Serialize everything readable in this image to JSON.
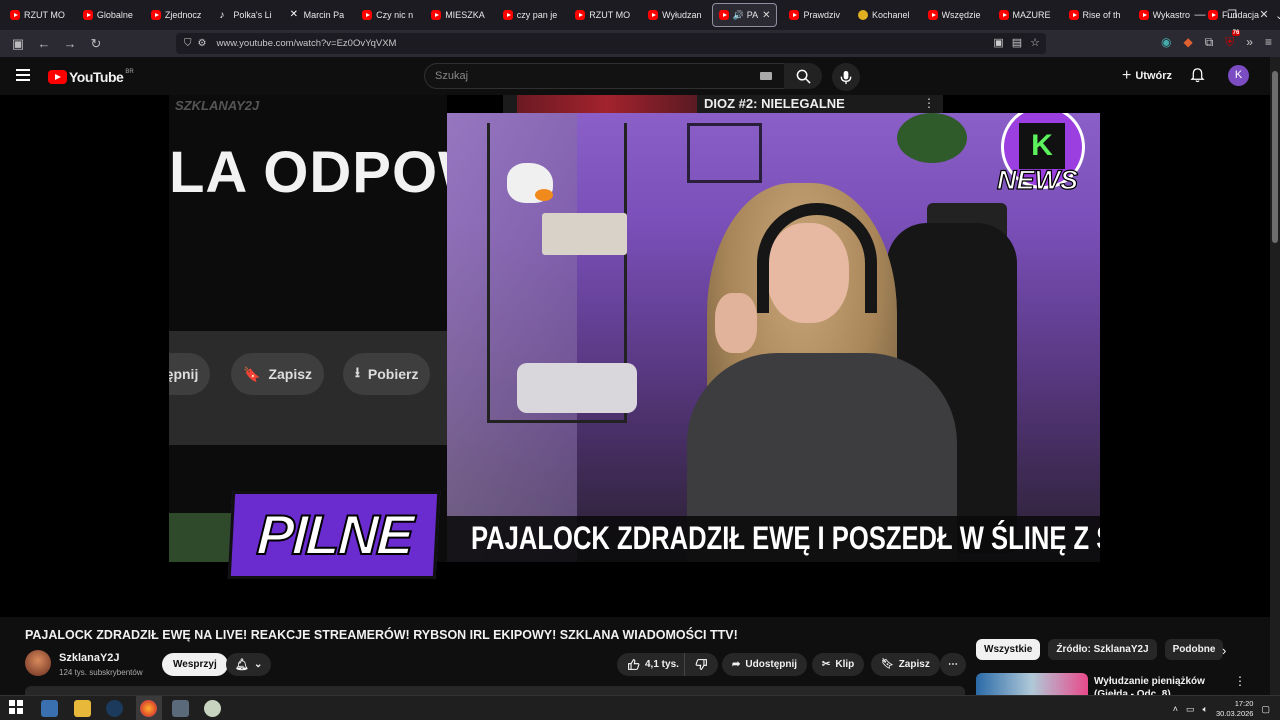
{
  "browser": {
    "tabs": [
      {
        "label": "RZUT MO",
        "icon": "youtube-icon"
      },
      {
        "label": "Globalne",
        "icon": "youtube-icon"
      },
      {
        "label": "Zjednocz",
        "icon": "youtube-icon"
      },
      {
        "label": "Polka's Li",
        "icon": "tiktok-icon"
      },
      {
        "label": "Marcin Pa",
        "icon": "x-icon"
      },
      {
        "label": "Czy nic n",
        "icon": "youtube-icon"
      },
      {
        "label": "MIESZKA",
        "icon": "youtube-icon"
      },
      {
        "label": "czy pan je",
        "icon": "youtube-icon"
      },
      {
        "label": "RZUT MO",
        "icon": "youtube-icon"
      },
      {
        "label": "Wyłudzan",
        "icon": "youtube-icon"
      },
      {
        "label": "PA",
        "icon": "youtube-icon",
        "active": true
      },
      {
        "label": "Prawdziv",
        "icon": "youtube-icon"
      },
      {
        "label": "Kochanel",
        "icon": "emoji-icon"
      },
      {
        "label": "Wszędzie",
        "icon": "youtube-icon"
      },
      {
        "label": "MAZURE",
        "icon": "youtube-icon"
      },
      {
        "label": "Rise of th",
        "icon": "youtube-icon"
      },
      {
        "label": "Wykastro",
        "icon": "youtube-icon"
      },
      {
        "label": "Fundacja",
        "icon": "youtube-icon"
      }
    ],
    "url": "www.youtube.com/watch?v=Ez0OvYqVXM",
    "extension_badge": "76"
  },
  "youtube": {
    "logo_text": "YouTube",
    "country_code": "BR",
    "search_placeholder": "Szukaj",
    "create_label": "Utwórz",
    "avatar_letter": "K"
  },
  "video": {
    "watermark": "SZKLANAY2J",
    "left_big_text": "LA ODPOW",
    "left_buttons": [
      "tępnij",
      "Zapisz",
      "Pobierz"
    ],
    "top_banner": "DIOZ #2: NIELEGALNE",
    "news_logo": "NEWS",
    "news_logo_letter": "K",
    "pilne": "PILNE",
    "lower_third": "PAJALOCK ZDRADZIŁ EWĘ I POSZEDŁ W ŚLINĘ Z S"
  },
  "watch": {
    "title": "PAJALOCK ZDRADZIŁ EWĘ NA LIVE! REAKCJE STREAMERÓW! RYBSON IRL EKIPOWY! SZKLANA WIADOMOŚCI TTV!",
    "channel_name": "SzklanaY2J",
    "subscribers": "124 tys. subskrybentów",
    "support_label": "Wesprzyj",
    "likes": "4,1 tys.",
    "share_label": "Udostępnij",
    "clip_label": "Klip",
    "save_label": "Zapisz"
  },
  "sidebar": {
    "chips": [
      "Wszystkie",
      "Źródło: SzklanaY2J",
      "Podobne"
    ],
    "recommendation_title": "Wyłudzanie pieniążków (Giełda - Odc. 8)"
  },
  "taskbar": {
    "time": "17:20",
    "date": "30.03.2026"
  },
  "colors": {
    "youtube_red": "#ff0000",
    "pilne_purple": "#6a2ccf",
    "avatar_purple": "#7b4cc2"
  }
}
